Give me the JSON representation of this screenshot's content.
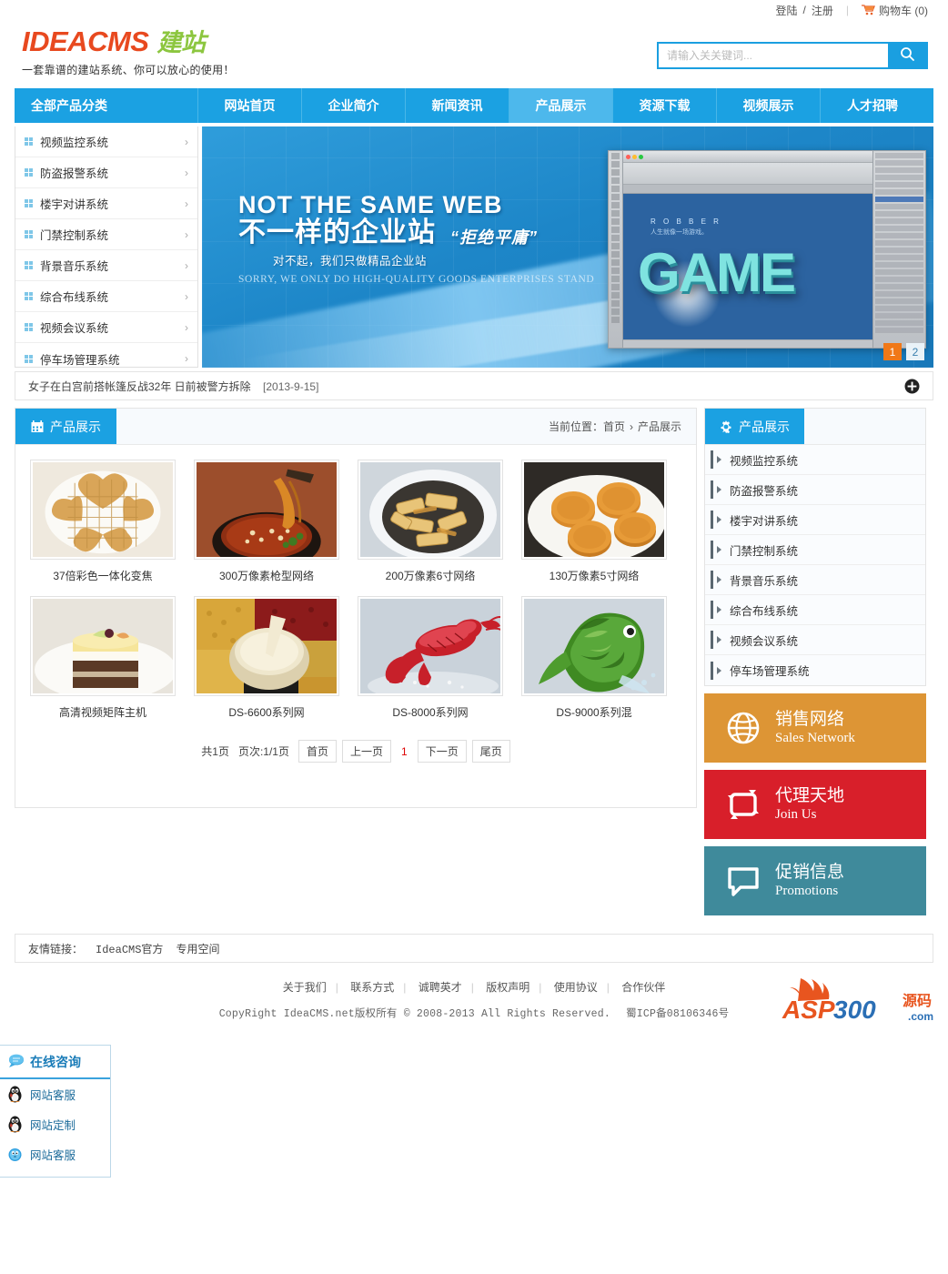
{
  "topbar": {
    "login": "登陆",
    "slash": "/",
    "register": "注册",
    "cart_label": "购物车 (0)",
    "cart_icon": "shopping-cart-icon"
  },
  "header": {
    "logo_main": "IDEACMS",
    "logo_sub": "建站",
    "slogan": "一套靠谱的建站系统、你可以放心的使用！",
    "search_placeholder": "请输入关关键词...",
    "search_value": "",
    "search_icon": "search-icon"
  },
  "nav": {
    "category_label": "全部产品分类",
    "items": [
      {
        "label": "网站首页",
        "active": false
      },
      {
        "label": "企业简介",
        "active": false
      },
      {
        "label": "新闻资讯",
        "active": false
      },
      {
        "label": "产品展示",
        "active": true
      },
      {
        "label": "资源下载",
        "active": false
      },
      {
        "label": "视频展示",
        "active": false
      },
      {
        "label": "人才招聘",
        "active": false
      }
    ]
  },
  "categories": [
    {
      "label": "视频监控系统",
      "arrow": "›"
    },
    {
      "label": "防盗报警系统",
      "arrow": "›"
    },
    {
      "label": "楼宇对讲系统",
      "arrow": "›"
    },
    {
      "label": "门禁控制系统",
      "arrow": "›"
    },
    {
      "label": "背景音乐系统",
      "arrow": "›"
    },
    {
      "label": "综合布线系统",
      "arrow": "›"
    },
    {
      "label": "视频会议系统",
      "arrow": "›"
    },
    {
      "label": "停车场管理系统",
      "arrow": "›"
    }
  ],
  "banner": {
    "headline_en": "NOT THE SAME WEB",
    "headline_cn": "不一样的企业站",
    "reject": "“拒绝平庸”",
    "subline_cn": "对不起，我们只做精品企业站",
    "subline_en": "SORRY, WE ONLY DO HIGH-QUALITY GOODS ENTERPRISES STAND",
    "art_brand": "R O B B E R",
    "art_tagline": "人生就像一场游戏。",
    "art_word": "GAME",
    "pages": [
      {
        "label": "1",
        "active": true
      },
      {
        "label": "2",
        "active": false
      }
    ]
  },
  "ticker": {
    "text": "女子在白宫前搭帐篷反战32年 日前被警方拆除",
    "date": "[2013-9-15]",
    "more_icon": "plus-circle-icon"
  },
  "content": {
    "title": "产品展示",
    "title_icon": "calendar-icon",
    "breadcrumb_prefix": "当前位置：",
    "breadcrumb_home": "首页",
    "breadcrumb_sep": "›",
    "breadcrumb_current": "产品展示",
    "products": [
      {
        "name": "37倍彩色一体化变焦",
        "image": "heart-shaped-waffles-on-white-plate"
      },
      {
        "name": "300万像素枪型网络",
        "image": "spicy-noodle-hotpot-with-chopsticks"
      },
      {
        "name": "200万像素6寸网络",
        "image": "fried-bamboo-shoots-in-bowl"
      },
      {
        "name": "130万像素5寸网络",
        "image": "four-mooncakes-on-white-plate"
      },
      {
        "name": "高清视频矩阵主机",
        "image": "layered-chocolate-mousse-cake"
      },
      {
        "name": "DS-6600系列网",
        "image": "soy-milk-bowl-with-grains"
      },
      {
        "name": "DS-8000系列网",
        "image": "red-lobster-on-blue-background"
      },
      {
        "name": "DS-9000系列混",
        "image": "green-vegetable-fish-sculpture"
      }
    ],
    "pagination": {
      "total": "共1页",
      "index": "页次:1/1页",
      "first": "首页",
      "prev": "上一页",
      "current": "1",
      "next": "下一页",
      "last": "尾页"
    }
  },
  "rside": {
    "title": "产品展示",
    "title_icon": "gear-icon",
    "items": [
      {
        "label": "视频监控系统"
      },
      {
        "label": "防盗报警系统"
      },
      {
        "label": "楼宇对讲系统"
      },
      {
        "label": "门禁控制系统"
      },
      {
        "label": "背景音乐系统"
      },
      {
        "label": "综合布线系统"
      },
      {
        "label": "视频会议系统"
      },
      {
        "label": "停车场管理系统"
      }
    ],
    "promos": [
      {
        "cn": "销售网络",
        "en": "Sales Network",
        "color": "#dd9535",
        "icon": "globe-icon"
      },
      {
        "cn": "代理天地",
        "en": "Join Us",
        "color": "#d81f2a",
        "icon": "refresh-loop-icon"
      },
      {
        "cn": "促销信息",
        "en": "Promotions",
        "color": "#3f8a9b",
        "icon": "speech-bubble-icon"
      }
    ]
  },
  "friendlinks": {
    "label": "友情链接：",
    "items": [
      "IdeaCMS官方",
      "专用空间"
    ]
  },
  "footer": {
    "nav": [
      "关于我们",
      "联系方式",
      "诚聘英才",
      "版权声明",
      "使用协议",
      "合作伙伴"
    ],
    "copyright": "CopyRight IdeaCMS.net版权所有 © 2008-2013 All Rights Reserved.",
    "icp": "蜀ICP备08106346号"
  },
  "chat": {
    "title": "在线咨询",
    "title_icon": "chat-bubble-icon",
    "items": [
      {
        "label": "网站客服",
        "icon": "qq-penguin-icon"
      },
      {
        "label": "网站定制",
        "icon": "qq-penguin-icon"
      },
      {
        "label": "网站客服",
        "icon": "qq-blue-icon"
      }
    ]
  },
  "watermark": {
    "text": "ASP300",
    "suffix_cn": "源码",
    "suffix_com": ".com"
  },
  "colors": {
    "brand_blue": "#1ba1e2",
    "logo_orange": "#e8491f",
    "logo_green": "#8cc63f",
    "active_tab": "#4db8ec",
    "pager_active": "#f07818"
  }
}
